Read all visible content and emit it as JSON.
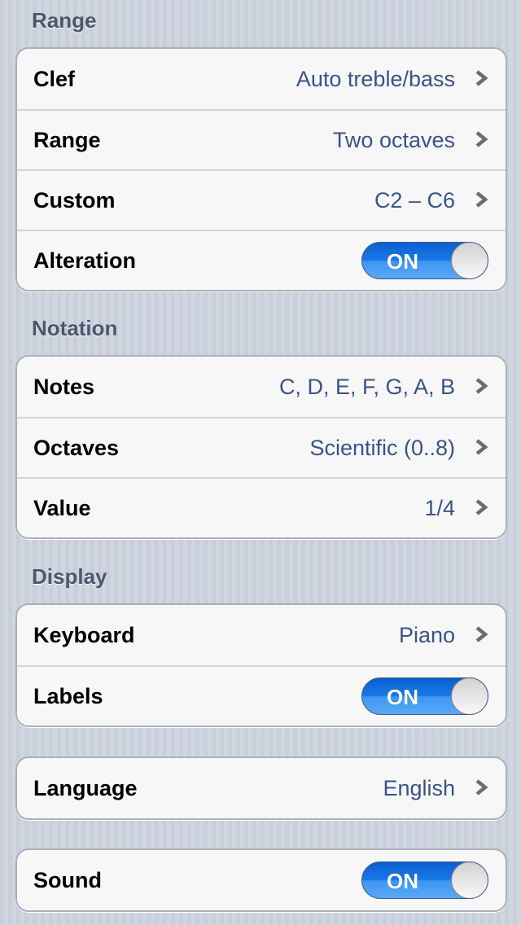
{
  "sections": [
    {
      "header": "Range",
      "rows": [
        {
          "label": "Clef",
          "value": "Auto treble/bass",
          "type": "disclosure"
        },
        {
          "label": "Range",
          "value": "Two octaves",
          "type": "disclosure"
        },
        {
          "label": "Custom",
          "value": "C2 – C6",
          "type": "disclosure"
        },
        {
          "label": "Alteration",
          "value": "ON",
          "type": "toggle",
          "on": true
        }
      ]
    },
    {
      "header": "Notation",
      "rows": [
        {
          "label": "Notes",
          "value": "C, D, E, F, G, A, B",
          "type": "disclosure"
        },
        {
          "label": "Octaves",
          "value": "Scientific (0..8)",
          "type": "disclosure"
        },
        {
          "label": "Value",
          "value": "1/4",
          "type": "disclosure"
        }
      ]
    },
    {
      "header": "Display",
      "rows": [
        {
          "label": "Keyboard",
          "value": "Piano",
          "type": "disclosure"
        },
        {
          "label": "Labels",
          "value": "ON",
          "type": "toggle",
          "on": true
        }
      ]
    },
    {
      "header": "",
      "rows": [
        {
          "label": "Language",
          "value": "English",
          "type": "disclosure"
        }
      ]
    },
    {
      "header": "",
      "rows": [
        {
          "label": "Sound",
          "value": "ON",
          "type": "toggle",
          "on": true
        }
      ]
    }
  ],
  "icons": {
    "disclosure": "chevron-right-icon"
  },
  "colors": {
    "value_text": "#385487",
    "toggle_on": "#1a7ae8",
    "header_text": "#4c566c"
  }
}
